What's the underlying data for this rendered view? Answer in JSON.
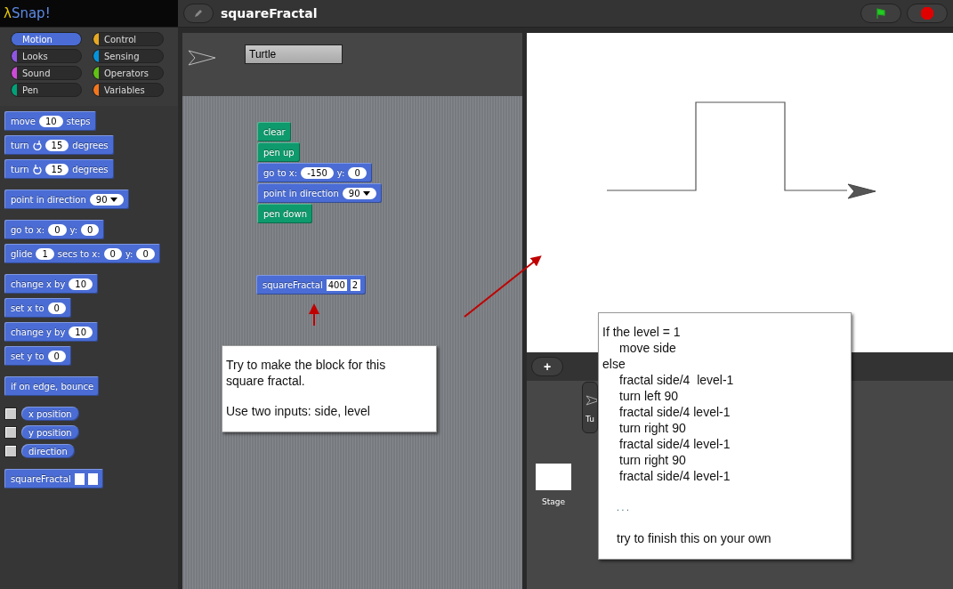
{
  "app": {
    "logo_symbol": "λ",
    "logo_text": "Snap!"
  },
  "project": {
    "title": "squareFractal"
  },
  "categories": [
    {
      "label": "Motion",
      "color": "#4a6cd4",
      "selected": true
    },
    {
      "label": "Control",
      "color": "#e6a822",
      "selected": false
    },
    {
      "label": "Looks",
      "color": "#8f56e3",
      "selected": false
    },
    {
      "label": "Sensing",
      "color": "#0494dc",
      "selected": false
    },
    {
      "label": "Sound",
      "color": "#cf4ad9",
      "selected": false
    },
    {
      "label": "Operators",
      "color": "#62c213",
      "selected": false
    },
    {
      "label": "Pen",
      "color": "#00a178",
      "selected": false
    },
    {
      "label": "Variables",
      "color": "#f3761d",
      "selected": false
    }
  ],
  "palette": {
    "groups": [
      [
        {
          "kind": "command",
          "color": "#4a6cd4",
          "parts": [
            {
              "kind": "label",
              "text": "move"
            },
            {
              "kind": "number",
              "text": "10"
            },
            {
              "kind": "label",
              "text": "steps"
            }
          ]
        },
        {
          "kind": "command",
          "color": "#4a6cd4",
          "parts": [
            {
              "kind": "label",
              "text": "turn"
            },
            {
              "kind": "clockwise"
            },
            {
              "kind": "number",
              "text": "15"
            },
            {
              "kind": "label",
              "text": "degrees"
            }
          ]
        },
        {
          "kind": "command",
          "color": "#4a6cd4",
          "parts": [
            {
              "kind": "label",
              "text": "turn"
            },
            {
              "kind": "counterclockwise"
            },
            {
              "kind": "number",
              "text": "15"
            },
            {
              "kind": "label",
              "text": "degrees"
            }
          ]
        }
      ],
      [
        {
          "kind": "command",
          "color": "#4a6cd4",
          "parts": [
            {
              "kind": "label",
              "text": "point in direction"
            },
            {
              "kind": "dropdown",
              "text": "90"
            }
          ]
        }
      ],
      [
        {
          "kind": "command",
          "color": "#4a6cd4",
          "parts": [
            {
              "kind": "label",
              "text": "go to x:"
            },
            {
              "kind": "number",
              "text": "0"
            },
            {
              "kind": "label",
              "text": "y:"
            },
            {
              "kind": "number",
              "text": "0"
            }
          ]
        },
        {
          "kind": "command",
          "color": "#4a6cd4",
          "parts": [
            {
              "kind": "label",
              "text": "glide"
            },
            {
              "kind": "number",
              "text": "1"
            },
            {
              "kind": "label",
              "text": "secs to x:"
            },
            {
              "kind": "number",
              "text": "0"
            },
            {
              "kind": "label",
              "text": "y:"
            },
            {
              "kind": "number",
              "text": "0"
            }
          ]
        }
      ],
      [
        {
          "kind": "command",
          "color": "#4a6cd4",
          "parts": [
            {
              "kind": "label",
              "text": "change x by"
            },
            {
              "kind": "number",
              "text": "10"
            }
          ]
        },
        {
          "kind": "command",
          "color": "#4a6cd4",
          "parts": [
            {
              "kind": "label",
              "text": "set x to"
            },
            {
              "kind": "number",
              "text": "0"
            }
          ]
        },
        {
          "kind": "command",
          "color": "#4a6cd4",
          "parts": [
            {
              "kind": "label",
              "text": "change y by"
            },
            {
              "kind": "number",
              "text": "10"
            }
          ]
        },
        {
          "kind": "command",
          "color": "#4a6cd4",
          "parts": [
            {
              "kind": "label",
              "text": "set y to"
            },
            {
              "kind": "number",
              "text": "0"
            }
          ]
        }
      ],
      [
        {
          "kind": "command",
          "color": "#4a6cd4",
          "parts": [
            {
              "kind": "label",
              "text": "if on edge, bounce"
            }
          ]
        }
      ],
      [
        {
          "kind": "reporter",
          "color": "#4a6cd4",
          "checked": false,
          "parts": [
            {
              "kind": "label",
              "text": "x position"
            }
          ]
        },
        {
          "kind": "reporter",
          "color": "#4a6cd4",
          "checked": false,
          "parts": [
            {
              "kind": "label",
              "text": "y position"
            }
          ]
        },
        {
          "kind": "reporter",
          "color": "#4a6cd4",
          "checked": false,
          "parts": [
            {
              "kind": "label",
              "text": "direction"
            }
          ]
        }
      ],
      [
        {
          "kind": "command",
          "color": "#4a6cd4",
          "parts": [
            {
              "kind": "label",
              "text": "squareFractal"
            },
            {
              "kind": "empty"
            },
            {
              "kind": "empty"
            }
          ]
        }
      ]
    ]
  },
  "sprite": {
    "name": "Turtle"
  },
  "scripts": [
    [
      {
        "color": "#0e9a6c",
        "parts": [
          {
            "kind": "label",
            "text": "clear"
          }
        ]
      },
      {
        "color": "#0e9a6c",
        "parts": [
          {
            "kind": "label",
            "text": "pen up"
          }
        ]
      },
      {
        "color": "#4a6cd4",
        "parts": [
          {
            "kind": "label",
            "text": "go to x:"
          },
          {
            "kind": "number",
            "text": "-150"
          },
          {
            "kind": "label",
            "text": "y:"
          },
          {
            "kind": "number",
            "text": "0"
          }
        ]
      },
      {
        "color": "#4a6cd4",
        "parts": [
          {
            "kind": "label",
            "text": "point in direction"
          },
          {
            "kind": "dropdown",
            "text": "90"
          }
        ]
      },
      {
        "color": "#0e9a6c",
        "parts": [
          {
            "kind": "label",
            "text": "pen down"
          }
        ]
      }
    ],
    [
      {
        "color": "#4a6cd4",
        "parts": [
          {
            "kind": "label",
            "text": "squareFractal"
          },
          {
            "kind": "box",
            "text": "400"
          },
          {
            "kind": "box",
            "text": "2"
          }
        ]
      }
    ]
  ],
  "corral": {
    "add_button": "+",
    "sprite_label": "Tu",
    "stage_label": "Stage"
  },
  "notes": [
    {
      "lines": [
        {
          "kind": "paragraph",
          "text": "Try to make the block for this square fractal."
        },
        {
          "kind": "paragraph",
          "text": "Use two inputs: side, level"
        }
      ]
    },
    {
      "lines": [
        {
          "kind": "code",
          "text": "If the level = 1",
          "children": [
            {
              "text": "move side"
            }
          ]
        },
        {
          "kind": "code",
          "text": "else",
          "children": [
            {
              "text": "fractal side/4  level-1"
            },
            {
              "text": "turn left 90"
            },
            {
              "text": "fractal side/4 level-1"
            },
            {
              "text": "turn right 90"
            },
            {
              "text": "fractal side/4 level-1"
            },
            {
              "text": "turn right 90"
            },
            {
              "text": "fractal side/4 level-1"
            }
          ]
        },
        {
          "kind": "ellipsis",
          "text": ". . ."
        },
        {
          "kind": "footer",
          "text": "try to finish this on your own"
        }
      ]
    }
  ]
}
